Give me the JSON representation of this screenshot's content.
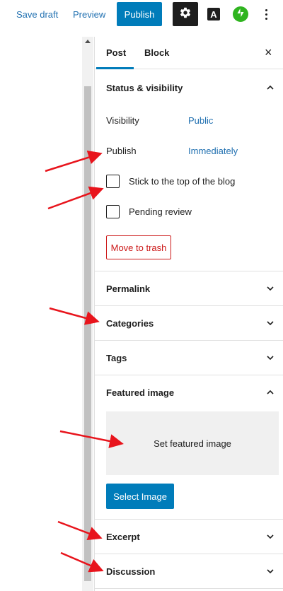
{
  "topbar": {
    "save_draft": "Save draft",
    "preview": "Preview",
    "publish": "Publish",
    "a_label": "A"
  },
  "tabs": {
    "post": "Post",
    "block": "Block",
    "close": "×"
  },
  "status_visibility": {
    "title": "Status & visibility",
    "visibility_label": "Visibility",
    "visibility_value": "Public",
    "publish_label": "Publish",
    "publish_value": "Immediately",
    "stick_label": "Stick to the top of the blog",
    "pending_label": "Pending review",
    "trash": "Move to trash"
  },
  "panels": {
    "permalink": "Permalink",
    "categories": "Categories",
    "tags": "Tags",
    "featured_image": "Featured image",
    "excerpt": "Excerpt",
    "discussion": "Discussion"
  },
  "featured": {
    "set_label": "Set featured image",
    "select_button": "Select Image"
  },
  "colors": {
    "accent": "#007cba",
    "link": "#2271b1",
    "danger": "#cc1818",
    "annotation_arrow": "#e8141c",
    "jetpack": "#2fb41f"
  },
  "icons": {
    "settings": "gear-icon",
    "jetpack": "jetpack-icon",
    "more": "more-vertical-icon",
    "expand": "chevron-down-icon",
    "collapse": "chevron-up-icon"
  }
}
